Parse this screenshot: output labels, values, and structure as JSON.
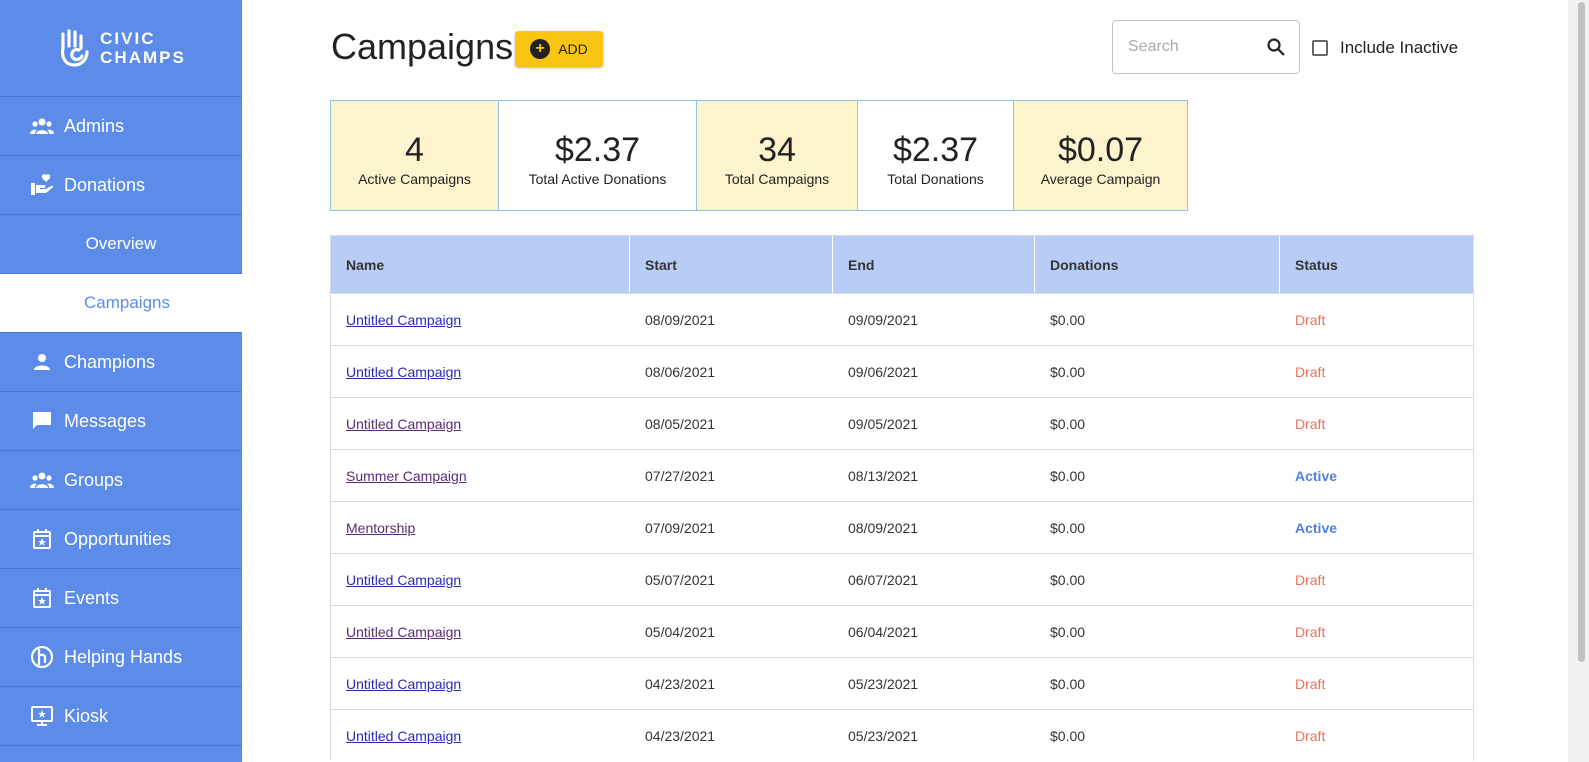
{
  "brand": {
    "line1": "CIVIC",
    "line2": "CHAMPS"
  },
  "sidebar": {
    "items": [
      {
        "label": "Admins",
        "icon": "people-icon"
      },
      {
        "label": "Donations",
        "icon": "donation-hand-icon"
      },
      {
        "label": "Overview",
        "sub": true
      },
      {
        "label": "Campaigns",
        "sub": true,
        "active": true
      },
      {
        "label": "Champions",
        "icon": "person-icon"
      },
      {
        "label": "Messages",
        "icon": "chat-icon"
      },
      {
        "label": "Groups",
        "icon": "people-icon"
      },
      {
        "label": "Opportunities",
        "icon": "calendar-star-icon"
      },
      {
        "label": "Events",
        "icon": "calendar-star-icon"
      },
      {
        "label": "Helping Hands",
        "icon": "helping-hands-icon"
      },
      {
        "label": "Kiosk",
        "icon": "kiosk-icon"
      }
    ]
  },
  "header": {
    "title": "Campaigns",
    "add_label": "ADD",
    "search_placeholder": "Search",
    "include_inactive_label": "Include Inactive"
  },
  "stats": [
    {
      "value": "4",
      "label": "Active Campaigns",
      "highlight": true
    },
    {
      "value": "$2.37",
      "label": "Total Active Donations",
      "highlight": false
    },
    {
      "value": "34",
      "label": "Total Campaigns",
      "highlight": true
    },
    {
      "value": "$2.37",
      "label": "Total Donations",
      "highlight": false
    },
    {
      "value": "$0.07",
      "label": "Average Campaign",
      "highlight": true
    }
  ],
  "table": {
    "columns": [
      "Name",
      "Start",
      "End",
      "Donations",
      "Status"
    ],
    "rows": [
      {
        "name": "Untitled Campaign",
        "start": "08/09/2021",
        "end": "09/09/2021",
        "donations": "$0.00",
        "status": "Draft",
        "visited": false
      },
      {
        "name": "Untitled Campaign",
        "start": "08/06/2021",
        "end": "09/06/2021",
        "donations": "$0.00",
        "status": "Draft",
        "visited": false
      },
      {
        "name": "Untitled Campaign",
        "start": "08/05/2021",
        "end": "09/05/2021",
        "donations": "$0.00",
        "status": "Draft",
        "visited": true
      },
      {
        "name": "Summer Campaign",
        "start": "07/27/2021",
        "end": "08/13/2021",
        "donations": "$0.00",
        "status": "Active",
        "visited": true
      },
      {
        "name": "Mentorship",
        "start": "07/09/2021",
        "end": "08/09/2021",
        "donations": "$0.00",
        "status": "Active",
        "visited": true
      },
      {
        "name": "Untitled Campaign",
        "start": "05/07/2021",
        "end": "06/07/2021",
        "donations": "$0.00",
        "status": "Draft",
        "visited": false
      },
      {
        "name": "Untitled Campaign",
        "start": "05/04/2021",
        "end": "06/04/2021",
        "donations": "$0.00",
        "status": "Draft",
        "visited": true
      },
      {
        "name": "Untitled Campaign",
        "start": "04/23/2021",
        "end": "05/23/2021",
        "donations": "$0.00",
        "status": "Draft",
        "visited": false
      },
      {
        "name": "Untitled Campaign",
        "start": "04/23/2021",
        "end": "05/23/2021",
        "donations": "$0.00",
        "status": "Draft",
        "visited": false
      }
    ]
  },
  "colors": {
    "sidebar": "#5c8ce8",
    "accent_yellow": "#f7c512",
    "draft": "#e8735a",
    "active": "#4f80dc"
  }
}
